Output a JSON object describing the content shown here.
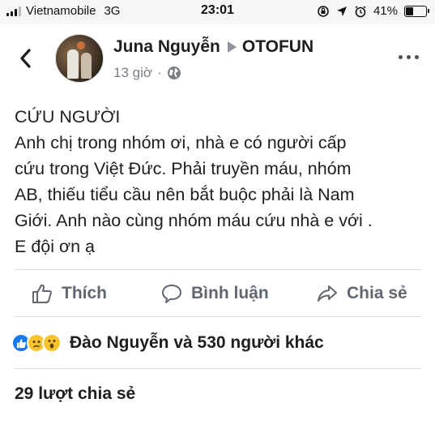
{
  "status_bar": {
    "carrier": "Vietnamobile",
    "network": "3G",
    "time": "23:01",
    "battery_percent": "41%",
    "battery_level": 0.41
  },
  "post": {
    "author": "Juna Nguyễn",
    "group": "OTOFUN",
    "time_ago": "13 giờ",
    "privacy_icon": "globe-icon",
    "body_lines": [
      "CỨU NGƯỜI",
      "Anh chị trong nhóm ơi, nhà e có người cấp",
      "cứu trong Việt Đức. Phải truyền máu, nhóm",
      "AB, thiếu tiểu cầu nên bắt buộc phải là Nam",
      "Giới. Anh nào cùng nhóm máu cứu nhà e với .",
      "E đội ơn ạ"
    ]
  },
  "actions": {
    "like_label": "Thích",
    "comment_label": "Bình luận",
    "share_label": "Chia sẻ"
  },
  "reactions": {
    "icons": [
      "like-reaction-icon",
      "sad-reaction-icon",
      "wow-reaction-icon"
    ],
    "summary": "Đào Nguyễn và 530 người khác"
  },
  "shares": {
    "label": "29 lượt chia sẻ"
  },
  "colors": {
    "like_blue": "#1877f2",
    "emoji_yellow": "#f7c52b",
    "secondary_text": "#606770",
    "divider": "#dadde1"
  }
}
